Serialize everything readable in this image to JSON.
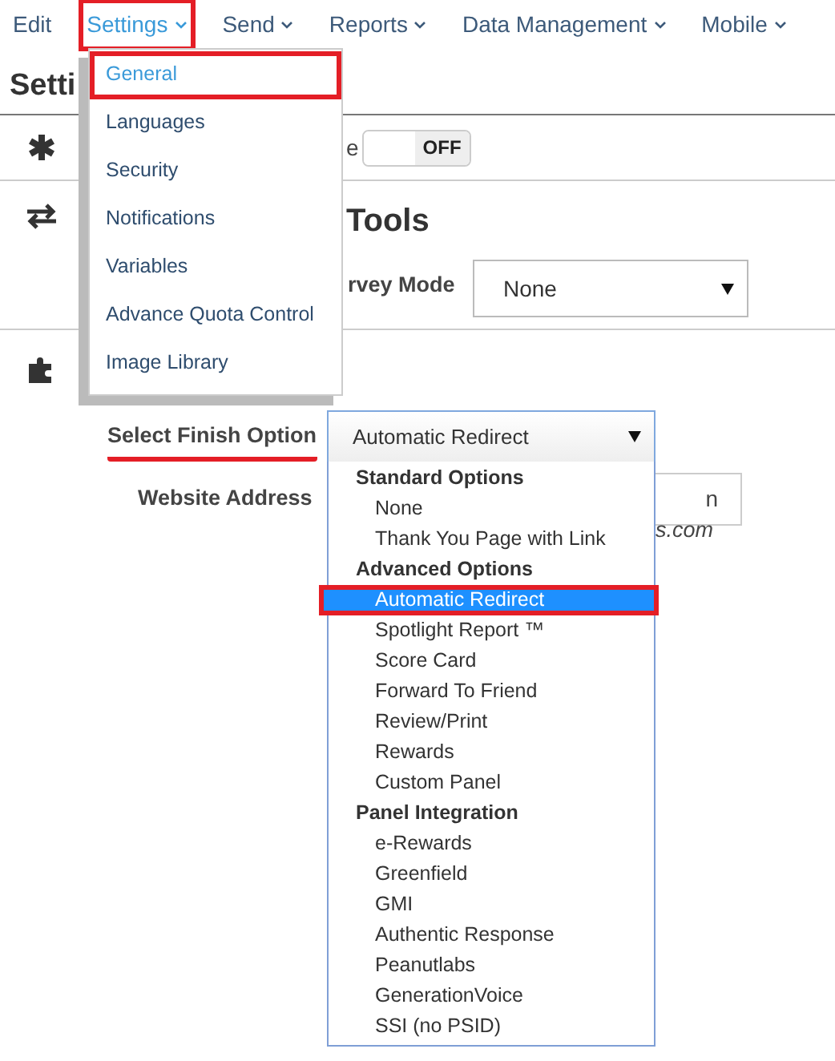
{
  "nav": [
    {
      "label": "Edit",
      "caret": false,
      "selected": false,
      "highlighted": false
    },
    {
      "label": "Settings",
      "caret": true,
      "selected": true,
      "highlighted": true
    },
    {
      "label": "Send",
      "caret": true,
      "selected": false,
      "highlighted": false
    },
    {
      "label": "Reports",
      "caret": true,
      "selected": false,
      "highlighted": false
    },
    {
      "label": "Data Management",
      "caret": true,
      "selected": false,
      "highlighted": false
    },
    {
      "label": "Mobile",
      "caret": true,
      "selected": false,
      "highlighted": false
    }
  ],
  "settings_menu": [
    {
      "label": "General",
      "selected": true,
      "highlighted": true
    },
    {
      "label": "Languages",
      "selected": false,
      "highlighted": false
    },
    {
      "label": "Security",
      "selected": false,
      "highlighted": false
    },
    {
      "label": "Notifications",
      "selected": false,
      "highlighted": false
    },
    {
      "label": "Variables",
      "selected": false,
      "highlighted": false
    },
    {
      "label": "Advance Quota Control",
      "selected": false,
      "highlighted": false
    },
    {
      "label": "Image Library",
      "selected": false,
      "highlighted": false
    }
  ],
  "page_title": "Setti",
  "general_row": {
    "toggle_label": "e",
    "toggle": {
      "on": false,
      "label": "OFF"
    }
  },
  "tools_section": {
    "heading": "Tools",
    "field_label": "rvey Mode",
    "select_value": "None"
  },
  "finish_section": {
    "field_label": "Select Finish Option",
    "underlined": true,
    "select_value": "Automatic Redirect",
    "website_label": "Website Address",
    "website_value": "n",
    "website_hint": "s.com"
  },
  "finish_options": [
    {
      "kind": "group",
      "label": "Standard Options"
    },
    {
      "kind": "option",
      "label": "None",
      "selected": false,
      "highlighted": false
    },
    {
      "kind": "option",
      "label": "Thank You Page with Link",
      "selected": false,
      "highlighted": false
    },
    {
      "kind": "group",
      "label": "Advanced Options"
    },
    {
      "kind": "option",
      "label": "Automatic Redirect",
      "selected": true,
      "highlighted": true
    },
    {
      "kind": "option",
      "label": "Spotlight Report ™",
      "selected": false,
      "highlighted": false
    },
    {
      "kind": "option",
      "label": "Score Card",
      "selected": false,
      "highlighted": false
    },
    {
      "kind": "option",
      "label": "Forward To Friend",
      "selected": false,
      "highlighted": false
    },
    {
      "kind": "option",
      "label": "Review/Print",
      "selected": false,
      "highlighted": false
    },
    {
      "kind": "option",
      "label": "Rewards",
      "selected": false,
      "highlighted": false
    },
    {
      "kind": "option",
      "label": "Custom Panel",
      "selected": false,
      "highlighted": false
    },
    {
      "kind": "group",
      "label": "Panel Integration"
    },
    {
      "kind": "option",
      "label": "e-Rewards",
      "selected": false,
      "highlighted": false
    },
    {
      "kind": "option",
      "label": "Greenfield",
      "selected": false,
      "highlighted": false
    },
    {
      "kind": "option",
      "label": "GMI",
      "selected": false,
      "highlighted": false
    },
    {
      "kind": "option",
      "label": "Authentic Response",
      "selected": false,
      "highlighted": false
    },
    {
      "kind": "option",
      "label": "Peanutlabs",
      "selected": false,
      "highlighted": false
    },
    {
      "kind": "option",
      "label": "GenerationVoice",
      "selected": false,
      "highlighted": false
    },
    {
      "kind": "option",
      "label": "SSI (no PSID)",
      "selected": false,
      "highlighted": false
    }
  ]
}
